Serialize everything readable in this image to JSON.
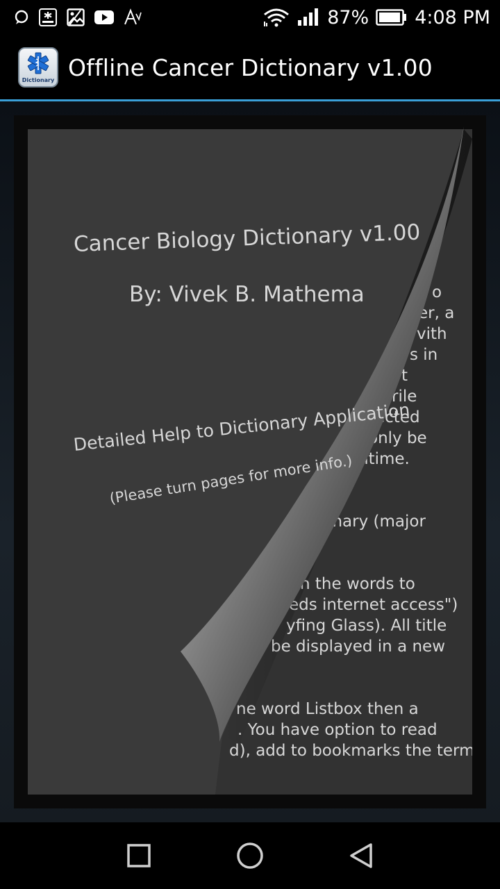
{
  "status_bar": {
    "battery_percent": "87%",
    "time": "4:08 PM",
    "icons": [
      "chat-icon",
      "app-notification-icon",
      "image-icon",
      "youtube-icon",
      "font-icon",
      "wifi-icon",
      "signal-icon",
      "battery-icon"
    ]
  },
  "action_bar": {
    "title": "Offline Cancer Dictionary v1.00",
    "icon_label": "Dictionary"
  },
  "front_page": {
    "title": "Cancer Biology Dictionary v1.00",
    "author": "By: Vivek B. Mathema",
    "help": "Detailed Help to Dictionary Application",
    "hint": "(Please turn pages for more info.)"
  },
  "next_page": {
    "lines": [
      "o",
      "er, a",
      "vith",
      "s in",
      "t",
      "rile",
      "ected",
      "only be",
      "ntime.",
      "ionary (major",
      "n the words to",
      "eds internet access\")",
      "yfing Glass). All title",
      "be displayed in a new",
      "ne word Listbox then a",
      ". You have option to read",
      "d), add to bookmarks the terms"
    ]
  },
  "nav_bar": {
    "buttons": [
      "recent-apps",
      "home",
      "back"
    ]
  },
  "colors": {
    "accent_divider": "#3aa0d8",
    "page_background": "#353535",
    "text": "#d7d7d7"
  }
}
